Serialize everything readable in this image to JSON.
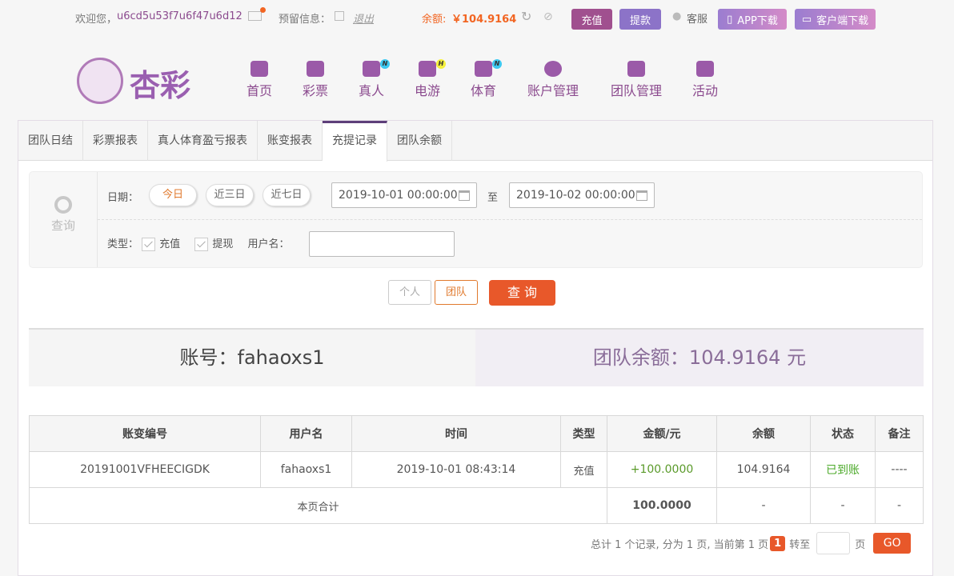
{
  "topbar": {
    "welcome": "欢迎您，",
    "username": "u6cd5u53f7u6f47u6d12",
    "reserved_label": "预留信息：",
    "logout": "退出",
    "balance_label": "余额:",
    "balance_value": "￥104.9164",
    "deposit": "充值",
    "withdraw": "提款",
    "service": "客服",
    "app_download": "APP下载",
    "client_download": "客户端下载"
  },
  "logo": {
    "text": "杏彩"
  },
  "nav": [
    {
      "label": "首页"
    },
    {
      "label": "彩票"
    },
    {
      "label": "真人",
      "badge": "N"
    },
    {
      "label": "电游",
      "badge": "H"
    },
    {
      "label": "体育",
      "badge": "N"
    },
    {
      "label": "账户管理"
    },
    {
      "label": "团队管理"
    },
    {
      "label": "活动"
    }
  ],
  "tabs": [
    "团队日结",
    "彩票报表",
    "真人体育盈亏报表",
    "账变报表",
    "充提记录",
    "团队余额"
  ],
  "query": {
    "icon_label": "查询",
    "date_label": "日期：",
    "today": "今日",
    "last3": "近三日",
    "last7": "近七日",
    "start": "2019-10-01 00:00:00",
    "to": "至",
    "end": "2019-10-02 00:00:00",
    "type_label": "类型：",
    "type_deposit": "充值",
    "type_withdraw": "提现",
    "username_label": "用户名：",
    "username_value": ""
  },
  "actions": {
    "personal": "个人",
    "team": "团队",
    "search": "查 询"
  },
  "summary": {
    "account": "账号：fahaoxs1",
    "team_balance": "团队余额：104.9164 元"
  },
  "table": {
    "headers": [
      "账变编号",
      "用户名",
      "时间",
      "类型",
      "金额/元",
      "余额",
      "状态",
      "备注"
    ],
    "rows": [
      [
        "20191001VFHEECIGDK",
        "fahaoxs1",
        "2019-10-01 08:43:14",
        "充值",
        "+100.0000",
        "104.9164",
        "已到账",
        "----"
      ]
    ],
    "total": {
      "label": "本页合计",
      "amount": "100.0000",
      "balance": "-",
      "status": "-",
      "note": "-"
    }
  },
  "pagination": {
    "summary": "总计 1 个记录, 分为 1 页, 当前第 1 页",
    "current": "1",
    "goto": "转至",
    "page": "页",
    "go": "GO"
  }
}
